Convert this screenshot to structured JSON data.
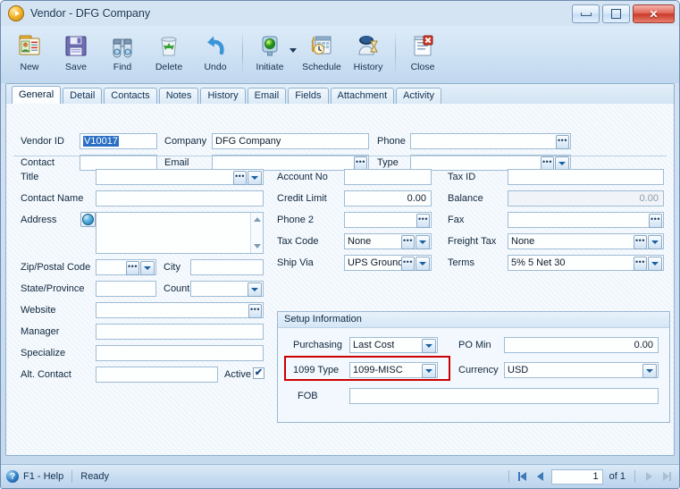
{
  "window": {
    "title": "Vendor - DFG Company",
    "title_icon": "play-circle-icon",
    "controls": {
      "minimize": "minimize-icon",
      "maximize": "maximize-icon",
      "close": "close-icon"
    }
  },
  "toolbar": {
    "buttons": [
      {
        "label": "New",
        "icon": "new-contact-card-icon"
      },
      {
        "label": "Save",
        "icon": "floppy-disk-icon"
      },
      {
        "label": "Find",
        "icon": "binoculars-icon"
      },
      {
        "label": "Delete",
        "icon": "recycle-bin-icon"
      },
      {
        "label": "Undo",
        "icon": "undo-arrow-icon"
      },
      {
        "label": "Initiate",
        "icon": "green-traffic-light-icon",
        "has_dropdown": true
      },
      {
        "label": "Schedule",
        "icon": "calendar-clock-icon"
      },
      {
        "label": "History",
        "icon": "hourglass-icon"
      },
      {
        "label": "Close",
        "icon": "document-red-x-icon"
      }
    ]
  },
  "tabs": [
    {
      "label": "General",
      "active": true
    },
    {
      "label": "Detail",
      "active": false
    },
    {
      "label": "Contacts",
      "active": false
    },
    {
      "label": "Notes",
      "active": false
    },
    {
      "label": "History",
      "active": false
    },
    {
      "label": "Email",
      "active": false
    },
    {
      "label": "Fields",
      "active": false
    },
    {
      "label": "Attachment",
      "active": false
    },
    {
      "label": "Activity",
      "active": false
    }
  ],
  "header_fields": {
    "vendor_id": {
      "label": "Vendor ID",
      "value": "V10017",
      "selected": true
    },
    "company": {
      "label": "Company",
      "value": "DFG Company"
    },
    "phone": {
      "label": "Phone",
      "value": ""
    },
    "contact": {
      "label": "Contact",
      "value": ""
    },
    "email": {
      "label": "Email",
      "value": ""
    },
    "type": {
      "label": "Type",
      "value": ""
    }
  },
  "left_column": {
    "title": {
      "label": "Title",
      "value": ""
    },
    "contact_name": {
      "label": "Contact Name",
      "value": ""
    },
    "address": {
      "label": "Address",
      "value": "",
      "map_icon": "globe-icon"
    },
    "zip": {
      "label": "Zip/Postal Code",
      "value": ""
    },
    "city": {
      "label": "City",
      "value": ""
    },
    "state": {
      "label": "State/Province",
      "value": ""
    },
    "country": {
      "label": "Country",
      "value": ""
    },
    "website": {
      "label": "Website",
      "value": ""
    },
    "manager": {
      "label": "Manager",
      "value": ""
    },
    "specialize": {
      "label": "Specialize",
      "value": ""
    },
    "alt_contact": {
      "label": "Alt. Contact",
      "value": ""
    },
    "active": {
      "label": "Active",
      "checked": true
    }
  },
  "middle_column": {
    "account_no": {
      "label": "Account No",
      "value": ""
    },
    "credit_limit": {
      "label": "Credit Limit",
      "value": "0.00"
    },
    "phone2": {
      "label": "Phone 2",
      "value": ""
    },
    "tax_code": {
      "label": "Tax Code",
      "value": "None"
    },
    "ship_via": {
      "label": "Ship Via",
      "value": "UPS Ground"
    }
  },
  "right_column": {
    "tax_id": {
      "label": "Tax ID",
      "value": ""
    },
    "balance": {
      "label": "Balance",
      "value": "0.00",
      "readonly": true
    },
    "fax": {
      "label": "Fax",
      "value": ""
    },
    "freight_tax": {
      "label": "Freight Tax",
      "value": "None"
    },
    "terms": {
      "label": "Terms",
      "value": "5% 5 Net 30"
    }
  },
  "setup_information": {
    "title": "Setup Information",
    "purchasing": {
      "label": "Purchasing",
      "value": "Last Cost"
    },
    "po_min": {
      "label": "PO Min",
      "value": "0.00"
    },
    "type_1099": {
      "label": "1099 Type",
      "value": "1099-MISC",
      "highlighted": true
    },
    "currency": {
      "label": "Currency",
      "value": "USD"
    },
    "fob": {
      "label": "FOB",
      "value": ""
    }
  },
  "status_bar": {
    "help": "F1 - Help",
    "status": "Ready",
    "nav": {
      "page": "1",
      "of": "of 1"
    }
  },
  "colors": {
    "accent": "#2b6fc4",
    "highlight_red": "#cc0000",
    "window_chrome": "#c5d9ee",
    "field_border": "#9fbcd6"
  }
}
